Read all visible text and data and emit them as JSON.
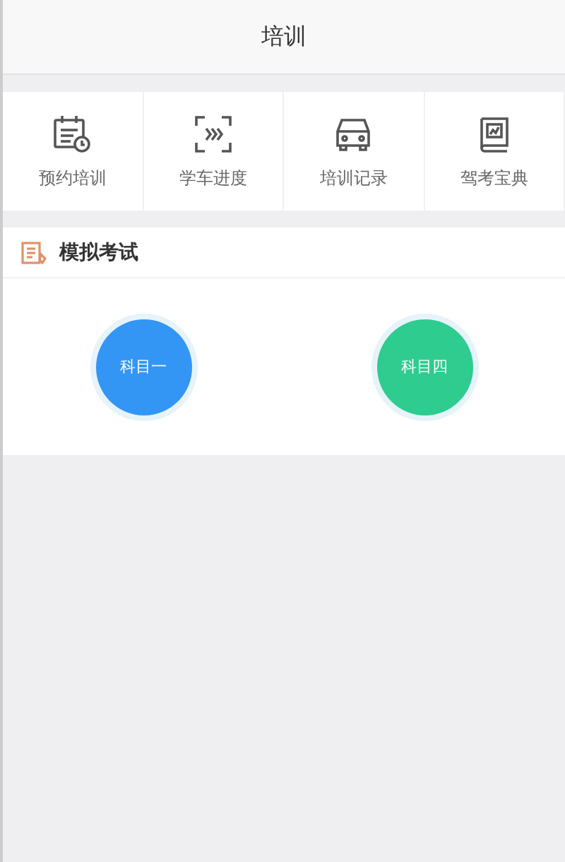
{
  "header": {
    "title": "培训"
  },
  "shortcuts": [
    {
      "kind": "calendar",
      "label": "预约培训"
    },
    {
      "kind": "scan",
      "label": "学车进度"
    },
    {
      "kind": "car",
      "label": "培训记录"
    },
    {
      "kind": "book",
      "label": "驾考宝典"
    }
  ],
  "mock_exam": {
    "title": "模拟考试",
    "subjects": [
      {
        "label": "科目一",
        "color": "#3396f5"
      },
      {
        "label": "科目四",
        "color": "#2ecc8f"
      }
    ]
  }
}
